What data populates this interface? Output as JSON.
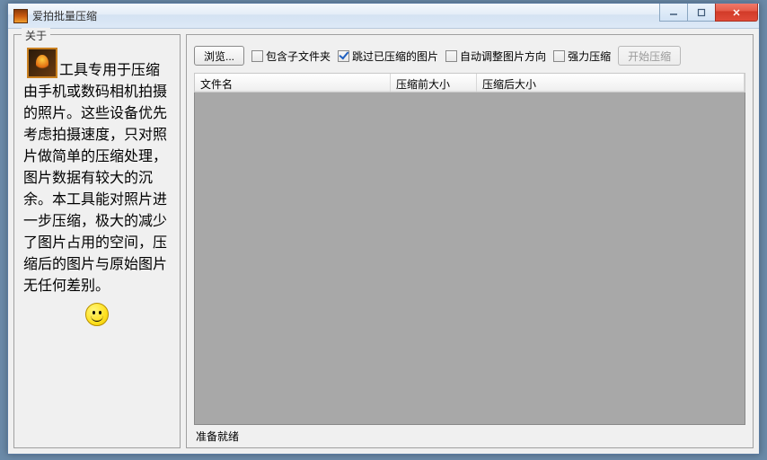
{
  "window": {
    "title": "爱拍批量压缩"
  },
  "about": {
    "title": "关于",
    "text": "工具专用于压缩由手机或数码相机拍摄的照片。这些设备优先考虑拍摄速度，只对照片做简单的压缩处理，图片数据有较大的沉余。本工具能对照片进一步压缩，极大的减少了图片占用的空间，压缩后的图片与原始图片无任何差别。"
  },
  "toolbar": {
    "browse": "浏览...",
    "include_sub": "包含子文件夹",
    "skip_compressed": "跳过已压缩的图片",
    "auto_orient": "自动调整图片方向",
    "strong_compress": "强力压缩",
    "start": "开始压缩"
  },
  "table": {
    "col_filename": "文件名",
    "col_before": "压缩前大小",
    "col_after": "压缩后大小"
  },
  "status": "准备就绪"
}
